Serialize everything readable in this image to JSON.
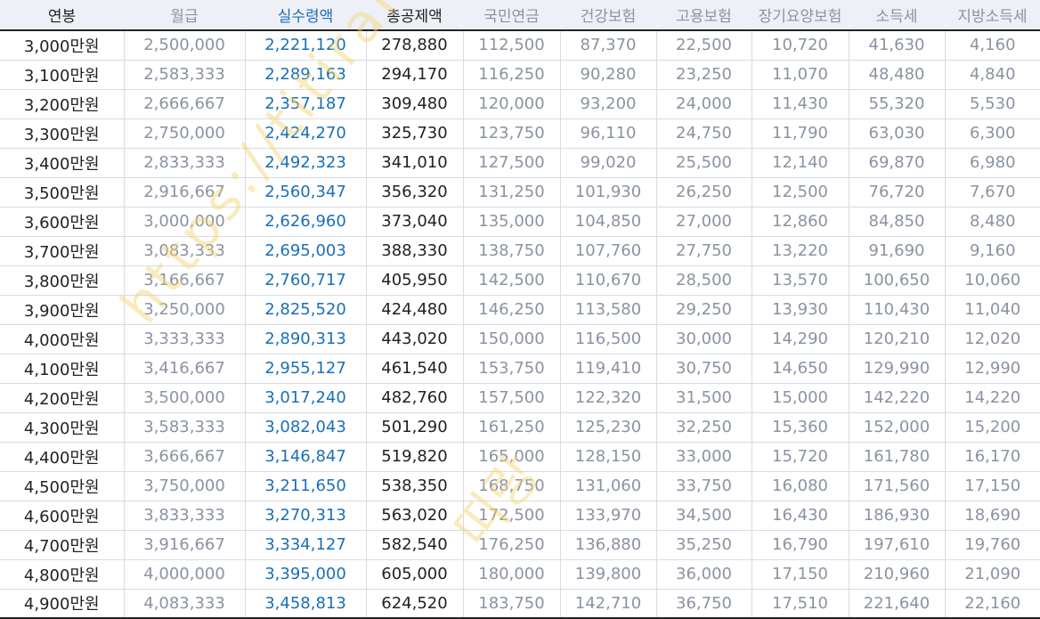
{
  "table": {
    "headers": [
      "연봉",
      "월급",
      "실수령액",
      "총공제액",
      "국민연금",
      "건강보험",
      "고용보험",
      "장기요양보험",
      "소득세",
      "지방소득세"
    ],
    "rows": [
      [
        "3,000만원",
        "2,500,000",
        "2,221,120",
        "278,880",
        "112,500",
        "87,370",
        "22,500",
        "10,720",
        "41,630",
        "4,160"
      ],
      [
        "3,100만원",
        "2,583,333",
        "2,289,163",
        "294,170",
        "116,250",
        "90,280",
        "23,250",
        "11,070",
        "48,480",
        "4,840"
      ],
      [
        "3,200만원",
        "2,666,667",
        "2,357,187",
        "309,480",
        "120,000",
        "93,200",
        "24,000",
        "11,430",
        "55,320",
        "5,530"
      ],
      [
        "3,300만원",
        "2,750,000",
        "2,424,270",
        "325,730",
        "123,750",
        "96,110",
        "24,750",
        "11,790",
        "63,030",
        "6,300"
      ],
      [
        "3,400만원",
        "2,833,333",
        "2,492,323",
        "341,010",
        "127,500",
        "99,020",
        "25,500",
        "12,140",
        "69,870",
        "6,980"
      ],
      [
        "3,500만원",
        "2,916,667",
        "2,560,347",
        "356,320",
        "131,250",
        "101,930",
        "26,250",
        "12,500",
        "76,720",
        "7,670"
      ],
      [
        "3,600만원",
        "3,000,000",
        "2,626,960",
        "373,040",
        "135,000",
        "104,850",
        "27,000",
        "12,860",
        "84,850",
        "8,480"
      ],
      [
        "3,700만원",
        "3,083,333",
        "2,695,003",
        "388,330",
        "138,750",
        "107,760",
        "27,750",
        "13,220",
        "91,690",
        "9,160"
      ],
      [
        "3,800만원",
        "3,166,667",
        "2,760,717",
        "405,950",
        "142,500",
        "110,670",
        "28,500",
        "13,570",
        "100,650",
        "10,060"
      ],
      [
        "3,900만원",
        "3,250,000",
        "2,825,520",
        "424,480",
        "146,250",
        "113,580",
        "29,250",
        "13,930",
        "110,430",
        "11,040"
      ],
      [
        "4,000만원",
        "3,333,333",
        "2,890,313",
        "443,020",
        "150,000",
        "116,500",
        "30,000",
        "14,290",
        "120,210",
        "12,020"
      ],
      [
        "4,100만원",
        "3,416,667",
        "2,955,127",
        "461,540",
        "153,750",
        "119,410",
        "30,750",
        "14,650",
        "129,990",
        "12,990"
      ],
      [
        "4,200만원",
        "3,500,000",
        "3,017,240",
        "482,760",
        "157,500",
        "122,320",
        "31,500",
        "15,000",
        "142,220",
        "14,220"
      ],
      [
        "4,300만원",
        "3,583,333",
        "3,082,043",
        "501,290",
        "161,250",
        "125,230",
        "32,250",
        "15,360",
        "152,000",
        "15,200"
      ],
      [
        "4,400만원",
        "3,666,667",
        "3,146,847",
        "519,820",
        "165,000",
        "128,150",
        "33,000",
        "15,720",
        "161,780",
        "16,170"
      ],
      [
        "4,500만원",
        "3,750,000",
        "3,211,650",
        "538,350",
        "168,750",
        "131,060",
        "33,750",
        "16,080",
        "171,560",
        "17,150"
      ],
      [
        "4,600만원",
        "3,833,333",
        "3,270,313",
        "563,020",
        "172,500",
        "133,970",
        "34,500",
        "16,430",
        "186,930",
        "18,690"
      ],
      [
        "4,700만원",
        "3,916,667",
        "3,334,127",
        "582,540",
        "176,250",
        "136,880",
        "35,250",
        "16,790",
        "197,610",
        "19,760"
      ],
      [
        "4,800만원",
        "4,000,000",
        "3,395,000",
        "605,000",
        "180,000",
        "139,800",
        "36,000",
        "17,150",
        "210,960",
        "21,090"
      ],
      [
        "4,900만원",
        "4,083,333",
        "3,458,813",
        "624,520",
        "183,750",
        "142,710",
        "36,750",
        "17,510",
        "221,640",
        "22,160"
      ]
    ]
  },
  "watermark": {
    "url": "https://titirang.com",
    "name": "띠랑"
  },
  "colors": {
    "header_bg": "#eef0f8",
    "accent_blue": "#1a6fb8",
    "muted_gray": "#8a93a3",
    "watermark": "#f5d26e"
  }
}
